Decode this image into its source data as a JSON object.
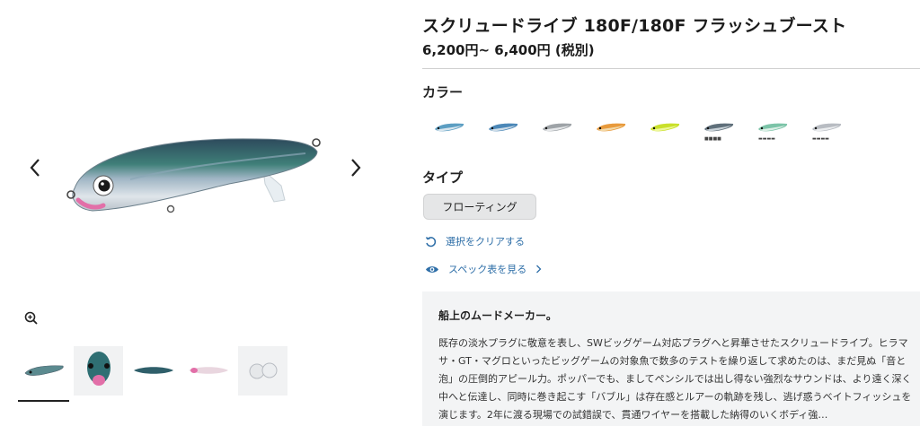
{
  "product": {
    "title": "スクリュードライブ 180F/180F フラッシュブースト",
    "price": "6,200円~ 6,400円 (税別)"
  },
  "colors": {
    "label": "カラー",
    "swatches": [
      {
        "name": "swatch-1",
        "body": "#5c9ec2",
        "belly": "#d9e6ee"
      },
      {
        "name": "swatch-2",
        "body": "#4c88b8",
        "belly": "#cfdde8"
      },
      {
        "name": "swatch-3",
        "body": "#9ea3a7",
        "belly": "#e6e8ea"
      },
      {
        "name": "swatch-4",
        "body": "#e89a3c",
        "belly": "#f3d9a8"
      },
      {
        "name": "swatch-5",
        "body": "#c9e02a",
        "belly": "#eef79a"
      },
      {
        "name": "swatch-6",
        "body": "#5f6f7a",
        "belly": "#c9d2d8",
        "tag": "■■■■"
      },
      {
        "name": "swatch-7",
        "body": "#7cc4a8",
        "belly": "#dcefe6",
        "tag": "▬▬▬▬"
      },
      {
        "name": "swatch-8",
        "body": "#b8bcc2",
        "belly": "#eceef0",
        "tag": "▬▬▬▬"
      }
    ]
  },
  "type": {
    "label": "タイプ",
    "selected": "フローティング"
  },
  "links": {
    "clear": "選択をクリアする",
    "spec": "スペック表を見る"
  },
  "description": {
    "heading": "船上のムードメーカー。",
    "body": "既存の淡水プラグに敬意を表し、SWビッグゲーム対応プラグへと昇華させたスクリュードライブ。ヒラマサ・GT・マグロといったビッグゲームの対象魚で数多のテストを繰り返して求めたのは、まだ見ぬ「音と泡」の圧倒的アピール力。ポッパーでも、ましてペンシルでは出し得ない強烈なサウンドは、より遠く深く中へと伝達し、同時に巻き起こす「バブル」は存在感とルアーの軌跡を残し、逃げ惑うベイトフィッシュを演じます。2年に渡る現場での試錯誤で、貫通ワイヤーを搭載した納得のいくボディ強…"
  },
  "gallery": {
    "accent": "#222222"
  }
}
